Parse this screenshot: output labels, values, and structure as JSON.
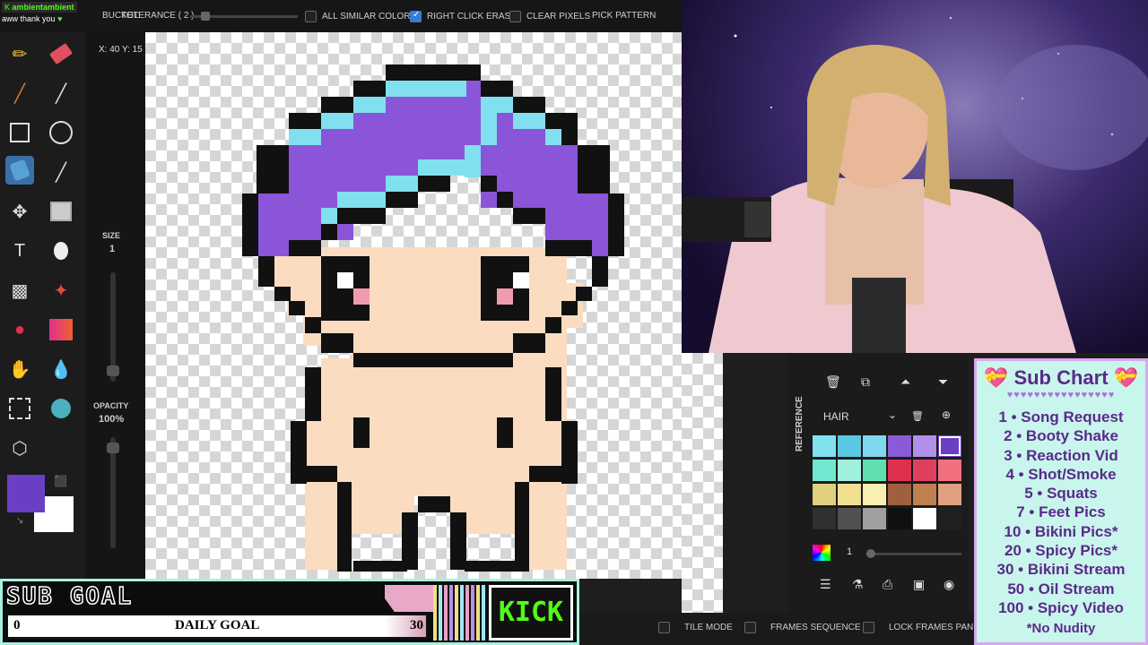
{
  "chat": {
    "username": "ambientambient",
    "message": "aww thank you"
  },
  "topbar": {
    "bucket_label": "BUCKET:",
    "tolerance_label": "TOLERANCE ( 2 )",
    "all_similar_colors": "ALL SIMILAR COLORS",
    "right_click_erase": "RIGHT CLICK ERASE",
    "clear_pixels": "CLEAR PIXELS",
    "pick_pattern": "PICK PATTERN"
  },
  "coords": "X: 40 Y: 15",
  "size_panel": {
    "size_label": "SIZE",
    "size_value": "1",
    "opacity_label": "OPACITY",
    "opacity_value": "100%"
  },
  "colors": {
    "primary": "#6b3fc4",
    "secondary": "#ffffff"
  },
  "layers": {
    "reference_tab": "REFERENCE",
    "palette_name": "HAIR",
    "brightness_value": "1",
    "swatches": [
      "#7fe0f0",
      "#5ac8e0",
      "#80d8f0",
      "#8a5ad8",
      "#b090e8",
      "#6b3fc4",
      "#70e8d0",
      "#a0f0e0",
      "#60e0b0",
      "#e03050",
      "#e04060",
      "#f07080",
      "#e0d080",
      "#f0e090",
      "#f8f0b0",
      "#a06040",
      "#c08050",
      "#e0a080",
      "#303030",
      "#505050",
      "#a0a0a0",
      "#101010",
      "#ffffff",
      "#202020"
    ]
  },
  "bottombar": {
    "tile_mode": "TILE MODE",
    "frames_sequence": "FRAMES SEQUENCE",
    "lock_frames": "LOCK FRAMES PANEL"
  },
  "subgoal": {
    "title": "SUB GOAL",
    "current": "0",
    "label": "DAILY GOAL",
    "target": "30",
    "platform": "KICK",
    "progress": 0
  },
  "subchart": {
    "title": "Sub Chart",
    "items": [
      "1 • Song Request",
      "2 • Booty Shake",
      "3 • Reaction Vid",
      "4 • Shot/Smoke",
      "5 • Squats",
      "7 • Feet Pics",
      "10 • Bikini Pics*",
      "20 • Spicy Pics*",
      "30 • Bikini Stream",
      "50 • Oil Stream",
      "100 • Spicy Video"
    ],
    "footer": "*No Nudity"
  }
}
